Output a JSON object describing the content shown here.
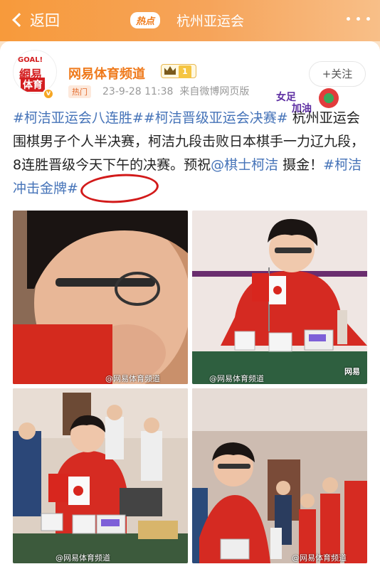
{
  "header": {
    "back_label": "返回",
    "hot_badge": "热点",
    "topic": "杭州亚运会"
  },
  "account": {
    "avatar_line1": "GOAL!",
    "avatar_line2": "網易",
    "avatar_line3": "体育",
    "name": "网易体育频道",
    "level": "1",
    "hot_tag": "热门",
    "timestamp": "23-9-28 11:38",
    "source": "来自微博网页版",
    "follow_label": "+关注"
  },
  "sticker": {
    "line1": "女足",
    "line2": "加油"
  },
  "post": {
    "tag1": "#柯洁亚运会八连胜#",
    "tag2": "#柯洁晋级亚运会决赛#",
    "text1": " 杭州亚运会围棋男子个人半决赛，柯洁九段击败日本棋手一力辽九段，8连胜晋级今天下午的决赛。预祝",
    "mention": "@棋士柯洁",
    "text2": " 摄金！",
    "tag3": "#柯洁冲击金牌#"
  },
  "photos": {
    "watermark": "@网易体育频道",
    "corner_logo": "网易"
  },
  "colors": {
    "header_orange": "#f79a3b",
    "accent_orange": "#ef7a1c",
    "link_blue": "#4573b8",
    "red_circle": "#d21a1a"
  }
}
